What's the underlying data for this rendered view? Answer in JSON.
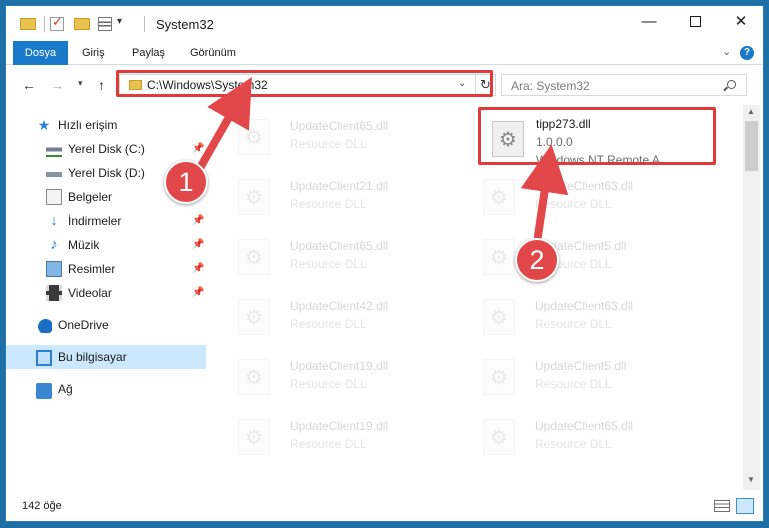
{
  "window": {
    "title": "System32",
    "minimize_glyph": "—",
    "close_glyph": "✕"
  },
  "ribbon": {
    "tabs": [
      "Dosya",
      "Giriş",
      "Paylaş",
      "Görünüm"
    ],
    "help_label": "?"
  },
  "address": {
    "path": "C:\\Windows\\System32"
  },
  "search": {
    "placeholder": "Ara: System32"
  },
  "sidebar": {
    "items": [
      {
        "label": "Hızlı erişim",
        "icon": "star-icon",
        "pinned": false
      },
      {
        "label": "Yerel Disk (C:)",
        "icon": "drive-icon",
        "pinned": true
      },
      {
        "label": "Yerel Disk (D:)",
        "icon": "drive-icon",
        "pinned": false
      },
      {
        "label": "Belgeler",
        "icon": "documents-icon",
        "pinned": true
      },
      {
        "label": "İndirmeler",
        "icon": "download-icon",
        "pinned": true
      },
      {
        "label": "Müzik",
        "icon": "music-icon",
        "pinned": true
      },
      {
        "label": "Resimler",
        "icon": "pictures-icon",
        "pinned": true
      },
      {
        "label": "Videolar",
        "icon": "videos-icon",
        "pinned": true
      },
      {
        "label": "OneDrive",
        "icon": "cloud-icon",
        "pinned": false
      },
      {
        "label": "Bu bilgisayar",
        "icon": "computer-icon",
        "pinned": false,
        "selected": true
      },
      {
        "label": "Ağ",
        "icon": "network-icon",
        "pinned": false
      }
    ]
  },
  "files": {
    "left_column": [
      {
        "name": "UpdateClient65.dll",
        "type": "Resource DLL"
      },
      {
        "name": "UpdateClient21.dll",
        "type": "Resource DLL"
      },
      {
        "name": "UpdateClient65.dll",
        "type": "Resource DLL"
      },
      {
        "name": "UpdateClient42.dll",
        "type": "Resource DLL"
      },
      {
        "name": "UpdateClient19.dll",
        "type": "Resource DLL"
      },
      {
        "name": "UpdateClient19.dll",
        "type": "Resource DLL"
      }
    ],
    "right_column": [
      {
        "name": "UpdateClient63.dll",
        "type": "Resource DLL"
      },
      {
        "name": "UpdateClient5.dll",
        "type": "Resource DLL"
      },
      {
        "name": "UpdateClient63.dll",
        "type": "Resource DLL"
      },
      {
        "name": "UpdateClient5.dll",
        "type": "Resource DLL"
      },
      {
        "name": "UpdateClient65.dll",
        "type": "Resource DLL"
      }
    ],
    "highlighted": {
      "name": "tipp273.dll",
      "version": "1.0.0.0",
      "description": "Windows NT Remote A..."
    }
  },
  "status": {
    "item_count": "142 öğe"
  },
  "annotations": {
    "marker_1": "1",
    "marker_2": "2",
    "color": "#e2474a"
  }
}
